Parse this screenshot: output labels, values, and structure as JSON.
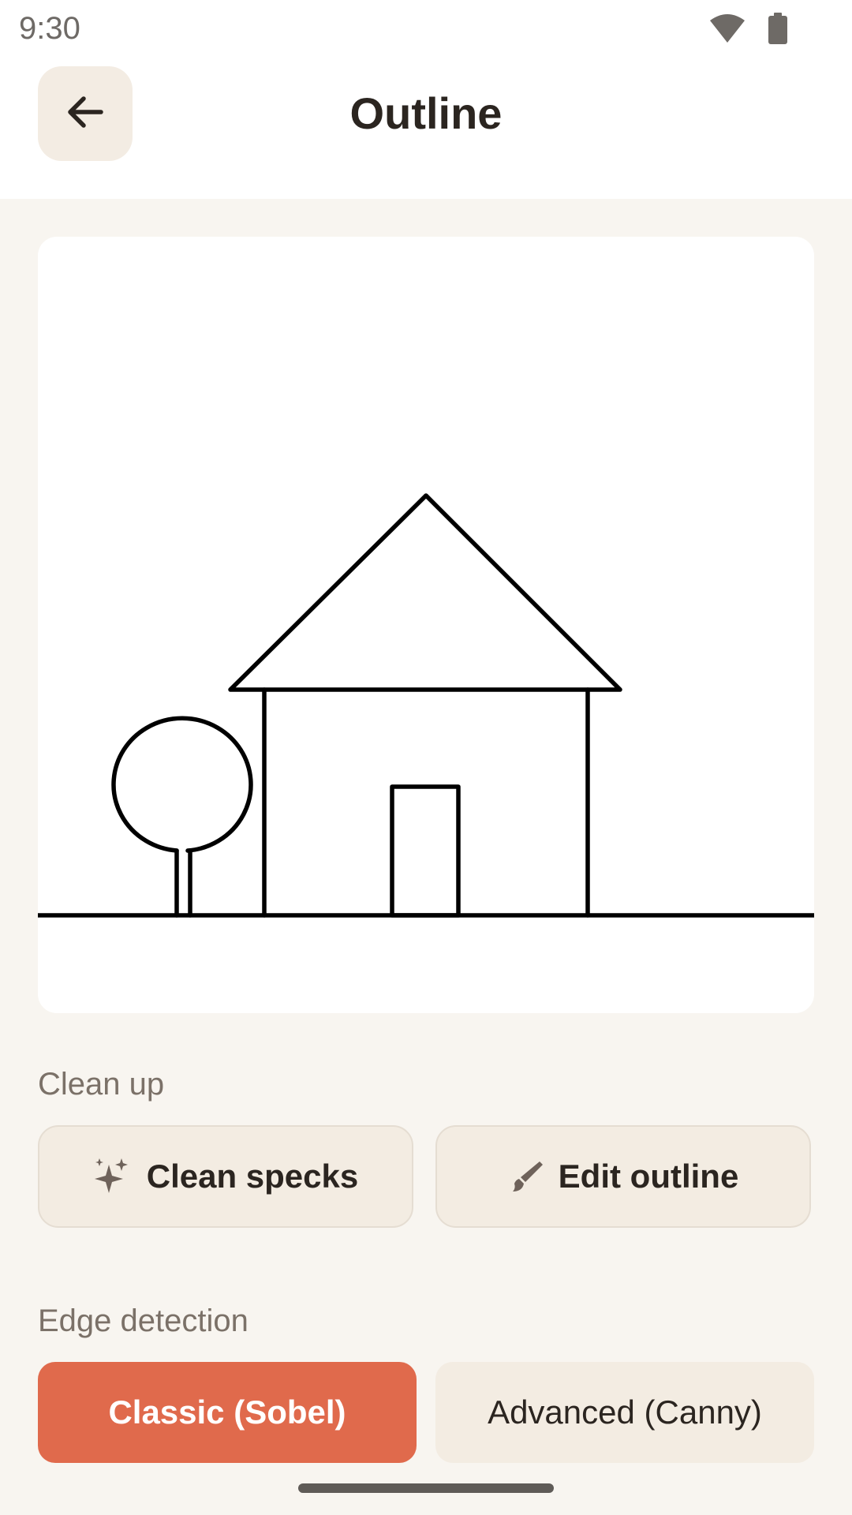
{
  "status_bar": {
    "time": "9:30",
    "wifi_icon": "wifi-icon",
    "battery_icon": "battery-icon"
  },
  "app_bar": {
    "back_icon": "arrow-left-icon",
    "title": "Outline"
  },
  "preview": {
    "description_icon": "house-outline-image"
  },
  "cleanup": {
    "section_label": "Clean up",
    "clean_specks_label": "Clean specks",
    "clean_specks_icon": "sparkle-icon",
    "edit_outline_label": "Edit outline",
    "edit_outline_icon": "brush-icon"
  },
  "edge_detection": {
    "section_label": "Edge detection",
    "options": [
      {
        "label": "Classic (Sobel)",
        "selected": true
      },
      {
        "label": "Advanced (Canny)",
        "selected": false
      }
    ]
  },
  "colors": {
    "accent": "#e06a4c",
    "background": "#f8f5f0",
    "button_bg": "#f3ece2",
    "text": "#2b2520",
    "muted_text": "#7b7168"
  }
}
